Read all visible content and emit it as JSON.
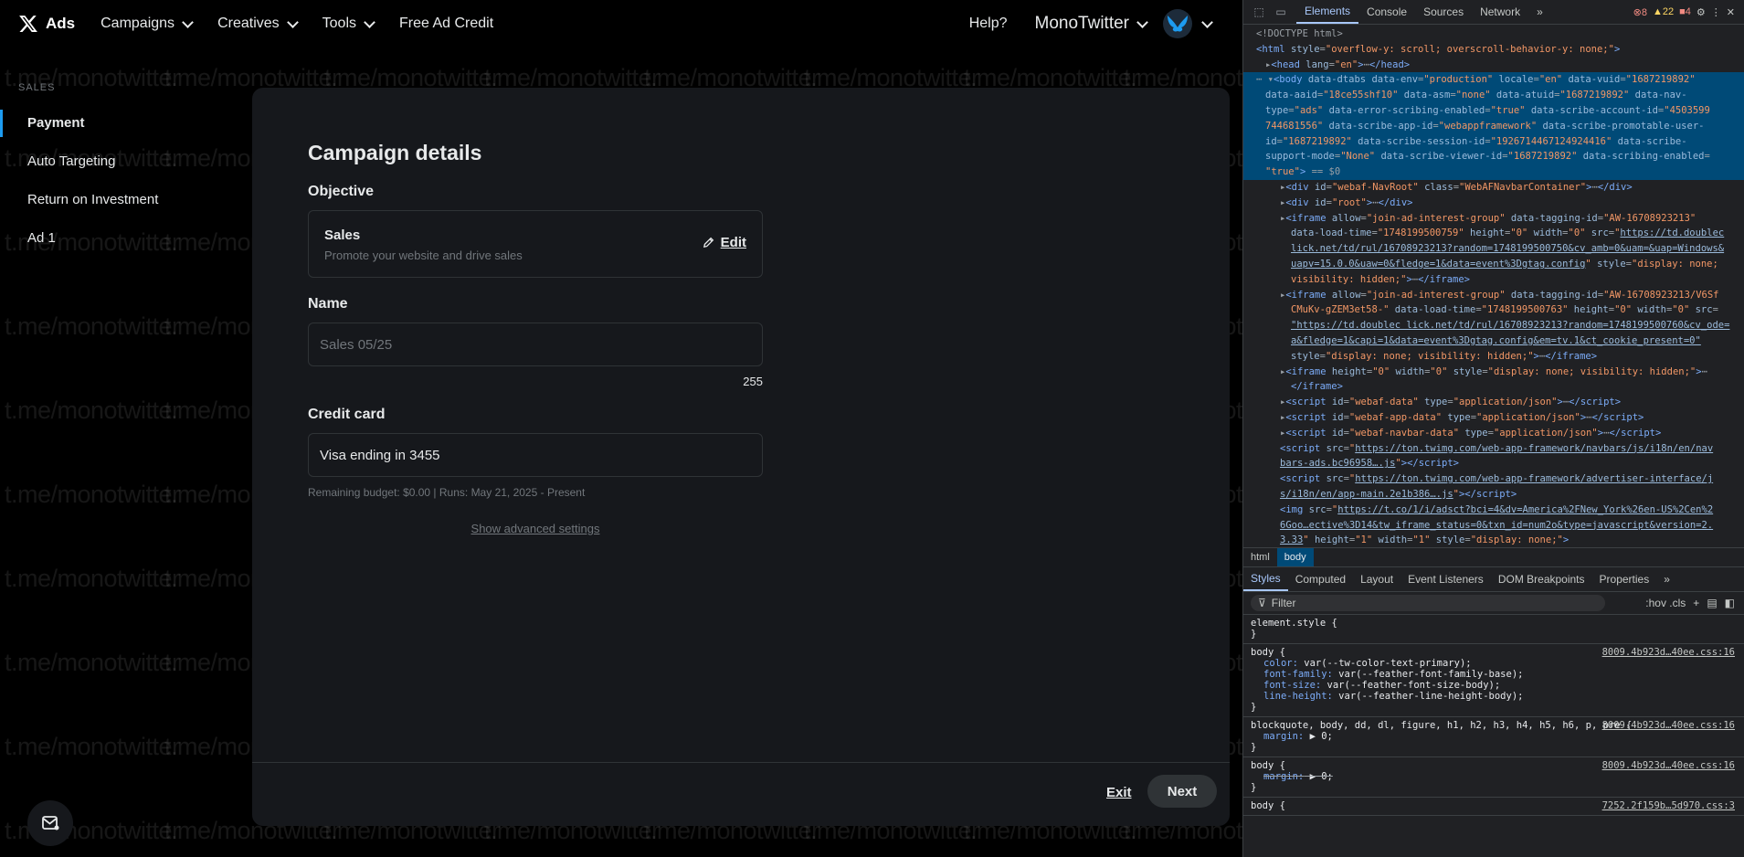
{
  "nav": {
    "brand": "Ads",
    "items": [
      "Campaigns",
      "Creatives",
      "Tools",
      "Free Ad Credit"
    ],
    "help": "Help?",
    "account": "MonoTwitter"
  },
  "watermark_text": "t.me/monotwitter",
  "sidebar": {
    "heading": "SALES",
    "items": [
      "Payment",
      "Auto Targeting",
      "Return on Investment",
      "Ad 1"
    ]
  },
  "form": {
    "title": "Campaign details",
    "objective_label": "Objective",
    "objective_title": "Sales",
    "objective_subtitle": "Promote your website and drive sales",
    "edit_label": "Edit",
    "name_label": "Name",
    "name_value": "Sales 05/25",
    "name_counter": "255",
    "card_label": "Credit card",
    "card_value": "Visa ending in 3455",
    "remaining": "Remaining budget: $0.00 | Runs: May 21, 2025 - Present",
    "advanced": "Show advanced settings",
    "exit_label": "Exit",
    "next_label": "Next"
  },
  "colors": {
    "accent": "#1d9bf0",
    "panel": "#16181c",
    "border": "#2f3336"
  },
  "devtools": {
    "tabs": [
      "Elements",
      "Console",
      "Sources",
      "Network"
    ],
    "errors": "8",
    "warnings": "22",
    "issues": "4",
    "crumbs": [
      "html",
      "body"
    ],
    "style_tabs": [
      "Styles",
      "Computed",
      "Layout",
      "Event Listeners",
      "DOM Breakpoints",
      "Properties"
    ],
    "filter_placeholder": "Filter",
    "filter_tools": ":hov .cls",
    "rules": [
      {
        "selector": "element.style {",
        "source": "",
        "props": []
      },
      {
        "selector": "body {",
        "source": "8009.4b923d…40ee.css:16",
        "props": [
          "color: var(--tw-color-text-primary);",
          "font-family: var(--feather-font-family-base);",
          "font-size: var(--feather-font-size-body);",
          "line-height: var(--feather-line-height-body);"
        ]
      },
      {
        "selector": "blockquote, body, dd, dl, figure, h1, h2, h3, h4, h5, h6, p, pre {",
        "source": "8009.4b923d…40ee.css:16",
        "props": [
          "margin: ▶ 0;"
        ]
      },
      {
        "selector": "body {",
        "source": "8009.4b923d…40ee.css:16",
        "props": [
          "margin: ▶ 0;"
        ],
        "strike": true
      },
      {
        "selector": "body {",
        "source": "7252.2f159b…5d970.css:3",
        "props": []
      }
    ]
  }
}
